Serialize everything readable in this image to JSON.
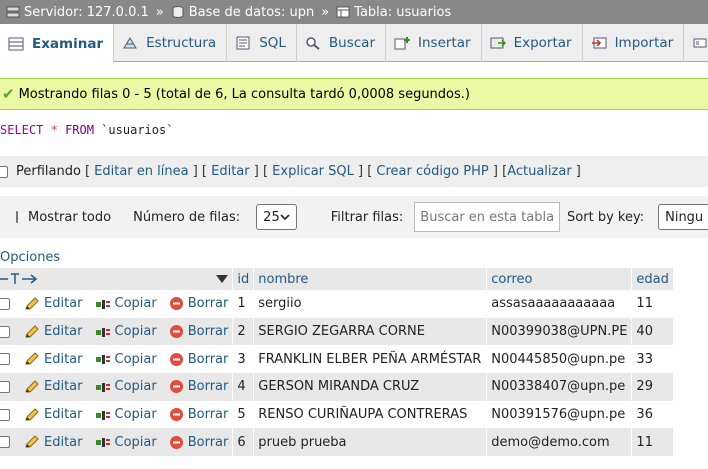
{
  "breadcrumb": {
    "server": "Servidor: 127.0.0.1",
    "database": "Base de datos: upn",
    "table": "Tabla: usuarios",
    "separator": "»"
  },
  "tabs": [
    {
      "label": "Examinar",
      "icon": "browse-icon",
      "active": true
    },
    {
      "label": "Estructura",
      "icon": "structure-icon"
    },
    {
      "label": "SQL",
      "icon": "sql-icon"
    },
    {
      "label": "Buscar",
      "icon": "search-icon"
    },
    {
      "label": "Insertar",
      "icon": "insert-icon"
    },
    {
      "label": "Exportar",
      "icon": "export-icon"
    },
    {
      "label": "Importar",
      "icon": "import-icon"
    }
  ],
  "message": "Mostrando filas 0 - 5 (total de 6, La consulta tardó 0,0008 segundos.)",
  "query": {
    "select": "SELECT",
    "star": "*",
    "from": "FROM",
    "table": "`usuarios`"
  },
  "profiling": {
    "label": "Perfilando",
    "links": [
      "Editar en línea",
      "Editar",
      "Explicar SQL",
      "Crear código PHP",
      "Actualizar"
    ]
  },
  "toolbar": {
    "show_all": "Mostrar todo",
    "rows_label": "Número de filas:",
    "rows_value": "25",
    "filter_label": "Filtrar filas:",
    "filter_placeholder": "Buscar en esta tabla",
    "sort_label": "Sort by key:",
    "sort_value": "Ningu"
  },
  "options_label": "Opciones",
  "columns": [
    "id",
    "nombre",
    "correo",
    "edad"
  ],
  "actions": {
    "edit": "Editar",
    "copy": "Copiar",
    "delete": "Borrar"
  },
  "rows": [
    {
      "id": "1",
      "nombre": "sergiio",
      "correo": "assasaaaaaaaaaaa",
      "edad": "11"
    },
    {
      "id": "2",
      "nombre": "SERGIO ZEGARRA CORNE",
      "correo": "N00399038@UPN.PE",
      "edad": "40"
    },
    {
      "id": "3",
      "nombre": "FRANKLIN ELBER PEÑA ARMÉSTAR",
      "correo": "N00445850@upn.pe",
      "edad": "33"
    },
    {
      "id": "4",
      "nombre": "GERSON MIRANDA CRUZ",
      "correo": "N00338407@upn.pe",
      "edad": "29"
    },
    {
      "id": "5",
      "nombre": "RENSO CURIÑAUPA CONTRERAS",
      "correo": "N00391576@upn.pe",
      "edad": "36"
    },
    {
      "id": "6",
      "nombre": "prueb prueba",
      "correo": "demo@demo.com",
      "edad": "11"
    }
  ],
  "colors": {
    "link": "#235a81",
    "success_bg": "#ebf8a4",
    "header_bg": "#888888"
  }
}
